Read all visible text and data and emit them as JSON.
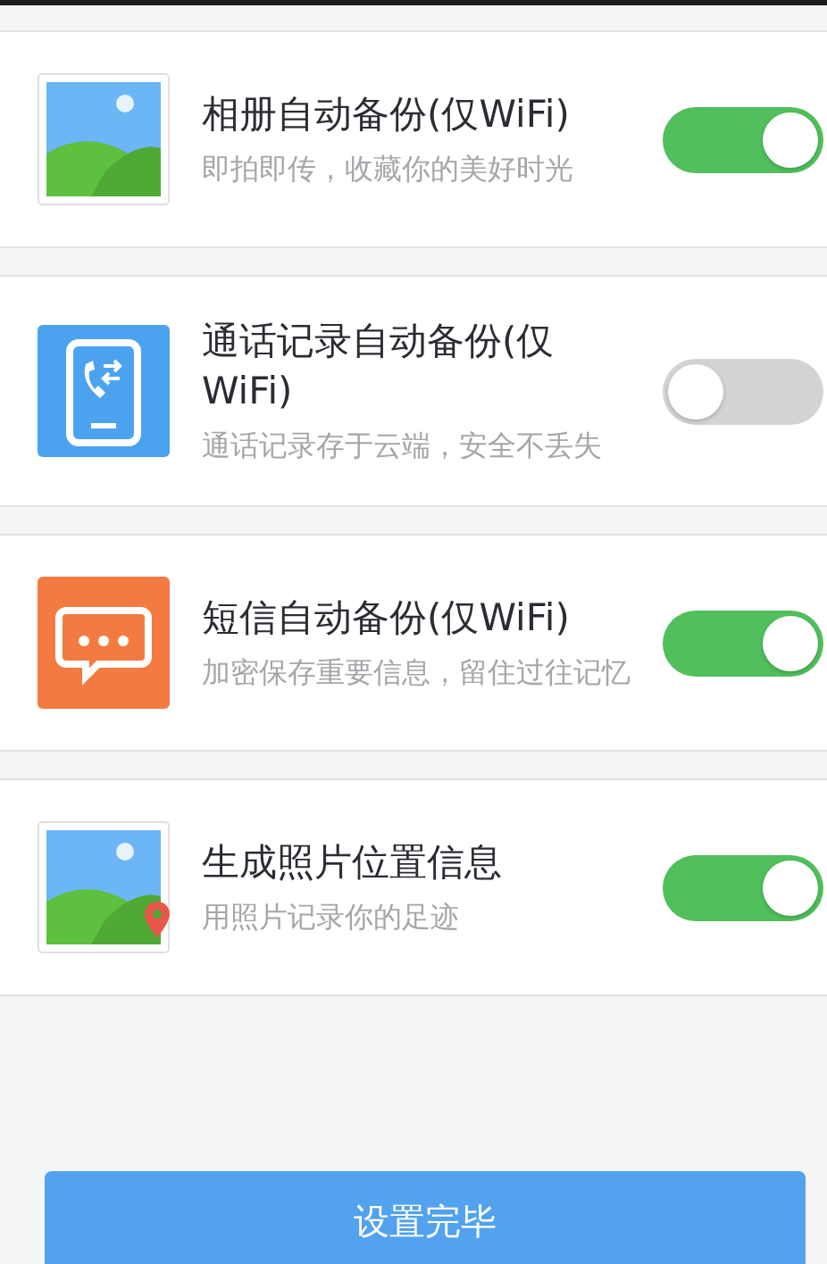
{
  "settings": [
    {
      "kind": "landscape",
      "title": "相册自动备份(仅WiFi)",
      "subtitle": "即拍即传，收藏你的美好时光",
      "on": true
    },
    {
      "kind": "phone",
      "title": "通话记录自动备份(仅WiFi)",
      "subtitle": "通话记录存于云端，安全不丢失",
      "on": false
    },
    {
      "kind": "message",
      "title": "短信自动备份(仅WiFi)",
      "subtitle": "加密保存重要信息，留住过往记忆",
      "on": true
    },
    {
      "kind": "landscape-pin",
      "title": "生成照片位置信息",
      "subtitle": "用照片记录你的足迹",
      "on": true
    }
  ],
  "done_button": "设置完毕"
}
